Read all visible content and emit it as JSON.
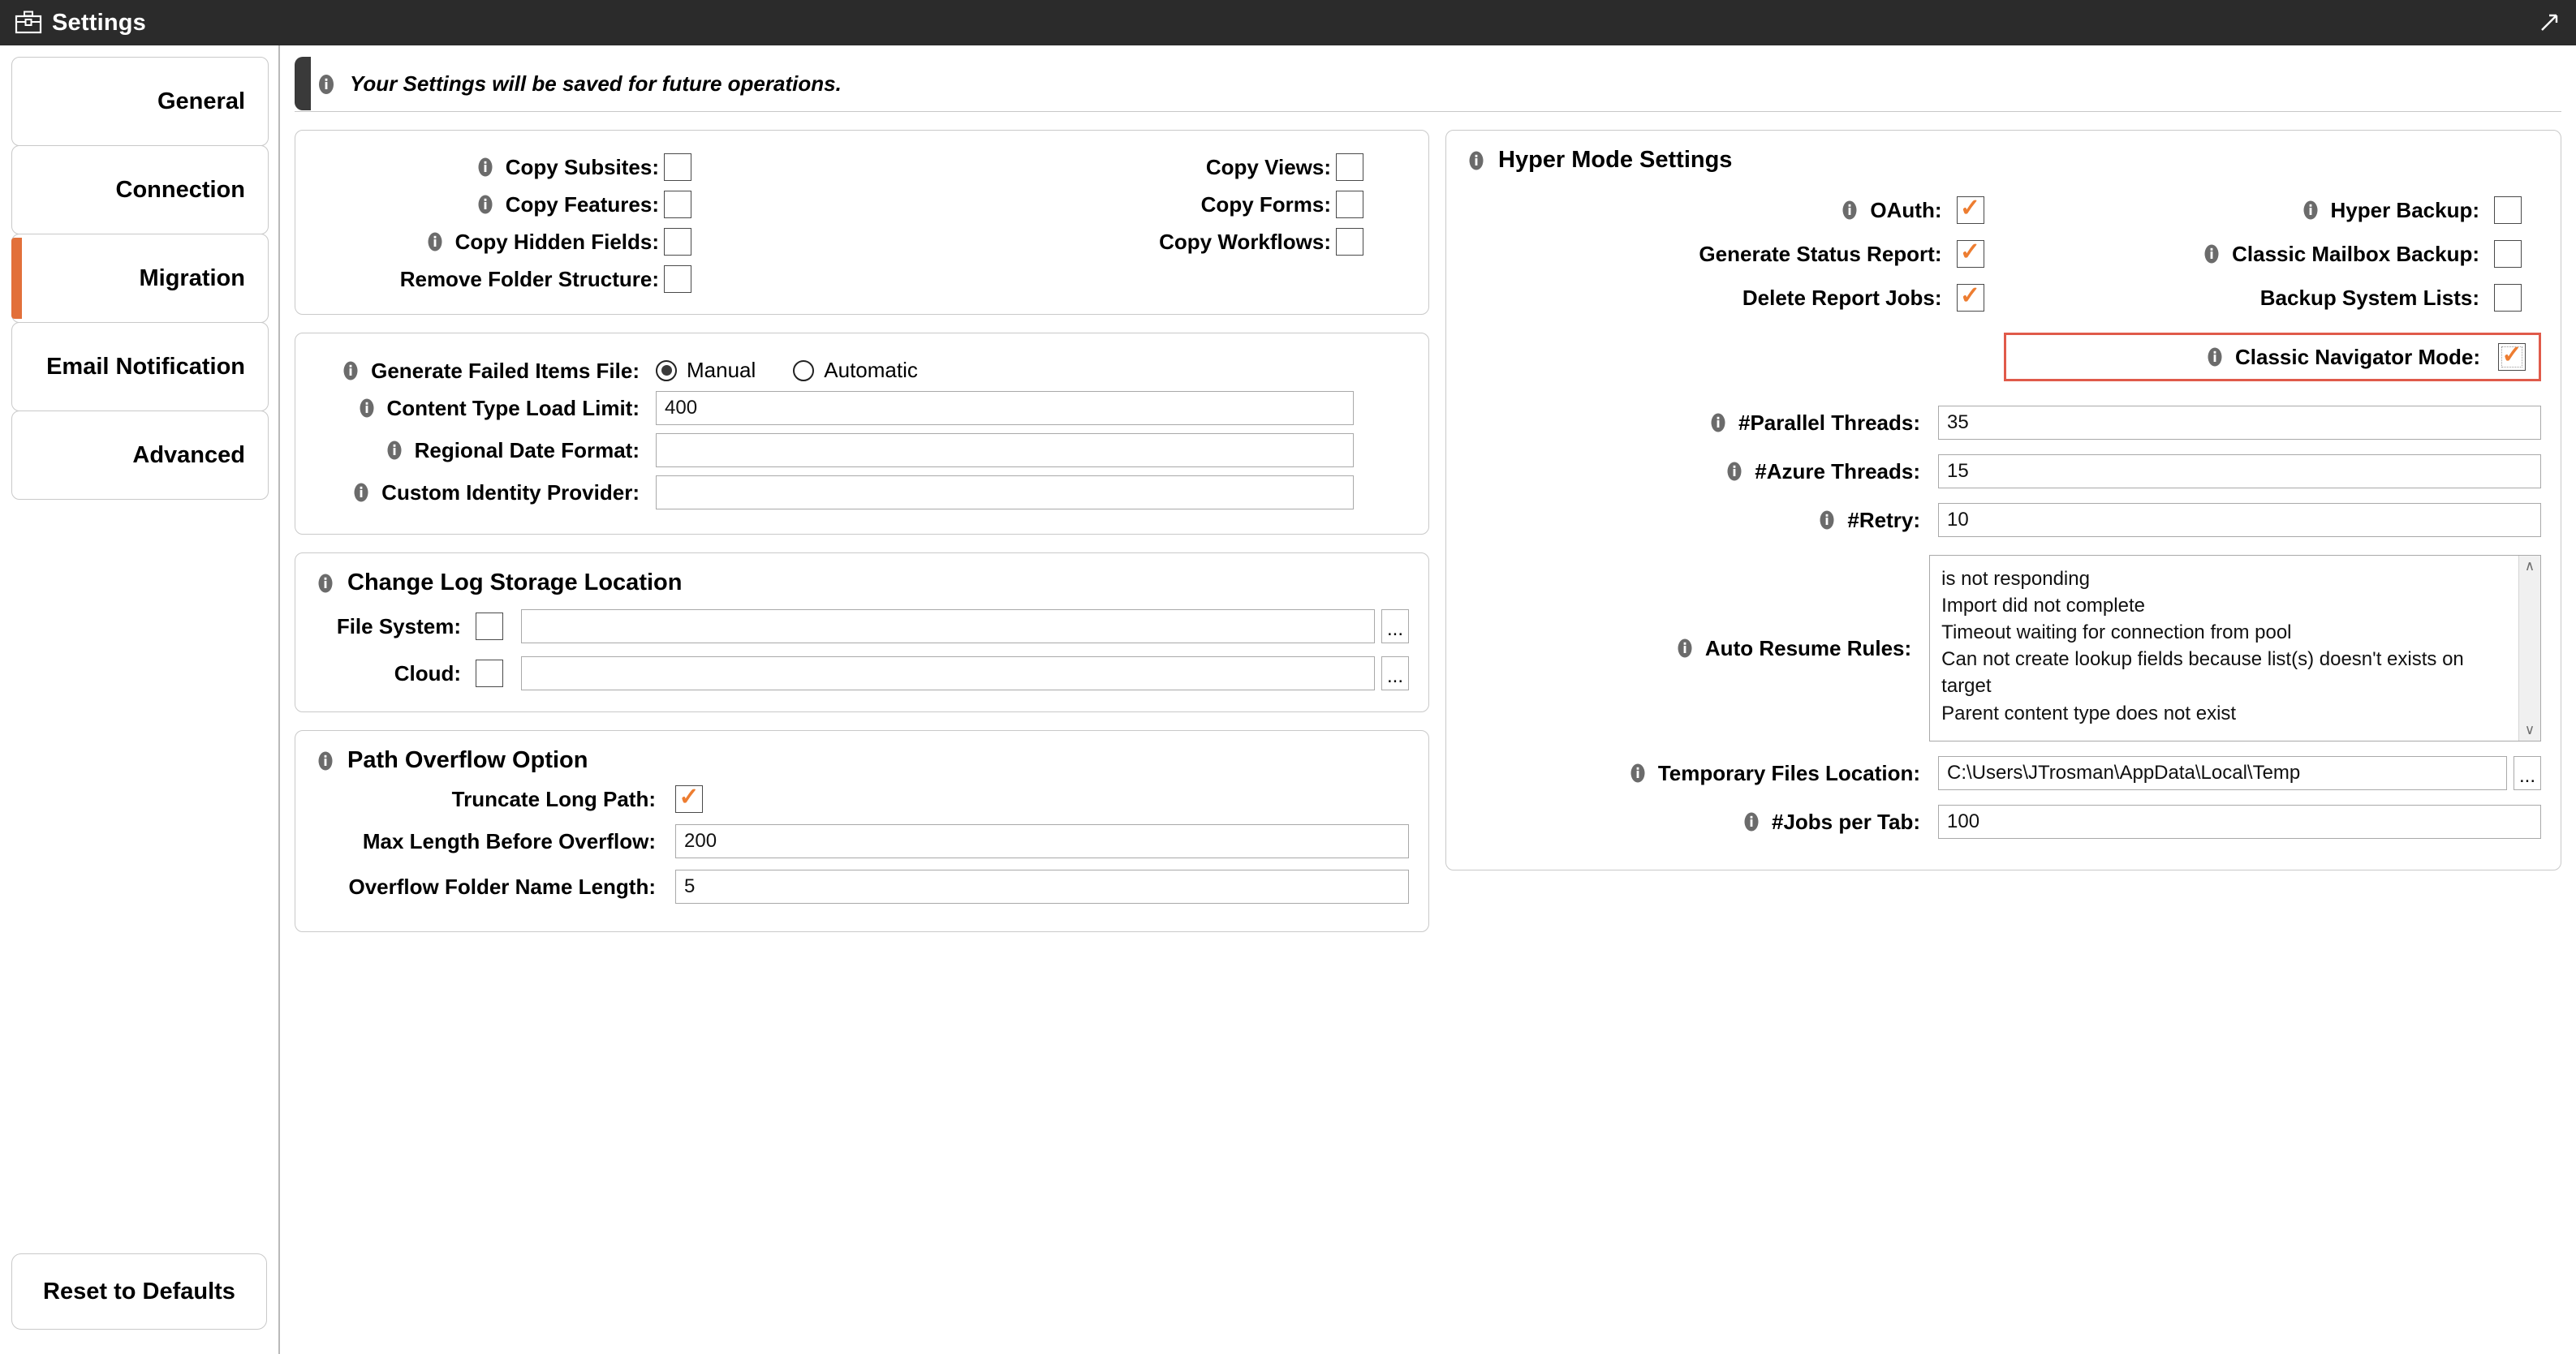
{
  "window": {
    "title": "Settings",
    "icon": "toolbox-icon",
    "expand_icon": "expand-arrow-icon"
  },
  "sidebar": {
    "items": [
      {
        "label": "General",
        "selected": false
      },
      {
        "label": "Connection",
        "selected": false
      },
      {
        "label": "Migration",
        "selected": true
      },
      {
        "label": "Email Notification",
        "selected": false
      },
      {
        "label": "Advanced",
        "selected": false
      }
    ],
    "reset_button": "Reset to Defaults",
    "accent_color": "#e2703a"
  },
  "banner": {
    "text": "Your Settings will be saved for future operations.",
    "icon": "info-icon"
  },
  "copy_options": {
    "rows": [
      {
        "left_label": "Copy Subsites:",
        "left_info": true,
        "left_checked": false,
        "right_label": "Copy Views:",
        "right_info": false,
        "right_checked": false
      },
      {
        "left_label": "Copy Features:",
        "left_info": true,
        "left_checked": false,
        "right_label": "Copy Forms:",
        "right_info": false,
        "right_checked": false
      },
      {
        "left_label": "Copy Hidden Fields:",
        "left_info": true,
        "left_checked": false,
        "right_label": "Copy Workflows:",
        "right_info": false,
        "right_checked": false
      },
      {
        "left_label": "Remove Folder Structure:",
        "left_info": false,
        "left_checked": false,
        "right_label": "",
        "right_info": false,
        "right_checked": null
      }
    ]
  },
  "general_options": {
    "generate_failed_items": {
      "label": "Generate Failed Items File:",
      "options": [
        {
          "label": "Manual",
          "selected": true
        },
        {
          "label": "Automatic",
          "selected": false
        }
      ]
    },
    "content_type_load_limit": {
      "label": "Content Type Load Limit:",
      "value": "400"
    },
    "regional_date_format": {
      "label": "Regional Date Format:",
      "value": ""
    },
    "custom_identity_provider": {
      "label": "Custom Identity Provider:",
      "value": ""
    }
  },
  "change_log": {
    "title": "Change Log Storage Location",
    "file_system": {
      "label": "File System:",
      "checked": false,
      "value": "",
      "browse": "..."
    },
    "cloud": {
      "label": "Cloud:",
      "checked": false,
      "value": "",
      "browse": "..."
    }
  },
  "path_overflow": {
    "title": "Path Overflow Option",
    "truncate_long_path": {
      "label": "Truncate Long Path:",
      "checked": true
    },
    "max_length_before_overflow": {
      "label": "Max Length Before Overflow:",
      "value": "200"
    },
    "overflow_folder_name_length": {
      "label": "Overflow Folder Name Length:",
      "value": "5"
    }
  },
  "hyper_mode": {
    "title": "Hyper Mode Settings",
    "checkbox_rows": [
      {
        "left_label": "OAuth:",
        "left_info": true,
        "left_checked": true,
        "right_label": "Hyper Backup:",
        "right_info": true,
        "right_checked": false
      },
      {
        "left_label": "Generate Status Report:",
        "left_info": false,
        "left_checked": true,
        "right_label": "Classic Mailbox Backup:",
        "right_info": true,
        "right_checked": false
      },
      {
        "left_label": "Delete Report Jobs:",
        "left_info": false,
        "left_checked": true,
        "right_label": "Backup System Lists:",
        "right_info": false,
        "right_checked": false
      }
    ],
    "classic_navigator_mode": {
      "label": "Classic Navigator Mode:",
      "checked": true,
      "highlighted": true,
      "highlight_color": "#e05a4a"
    },
    "parallel_threads": {
      "label": "#Parallel Threads:",
      "value": "35"
    },
    "azure_threads": {
      "label": "#Azure Threads:",
      "value": "15"
    },
    "retry": {
      "label": "#Retry:",
      "value": "10"
    },
    "auto_resume_rules": {
      "label": "Auto Resume Rules:",
      "value": "is not responding\nImport did not complete\nTimeout waiting for connection from pool\nCan not create lookup fields because list(s) doesn't exists on target\nParent content type does not exist"
    },
    "temporary_files_location": {
      "label": "Temporary Files Location:",
      "value": "C:\\Users\\JTrosman\\AppData\\Local\\Temp",
      "browse": "..."
    },
    "jobs_per_tab": {
      "label": "#Jobs per Tab:",
      "value": "100"
    }
  },
  "glyphs": {
    "check": "✓",
    "scroll_up": "∧",
    "scroll_down": "∨"
  }
}
